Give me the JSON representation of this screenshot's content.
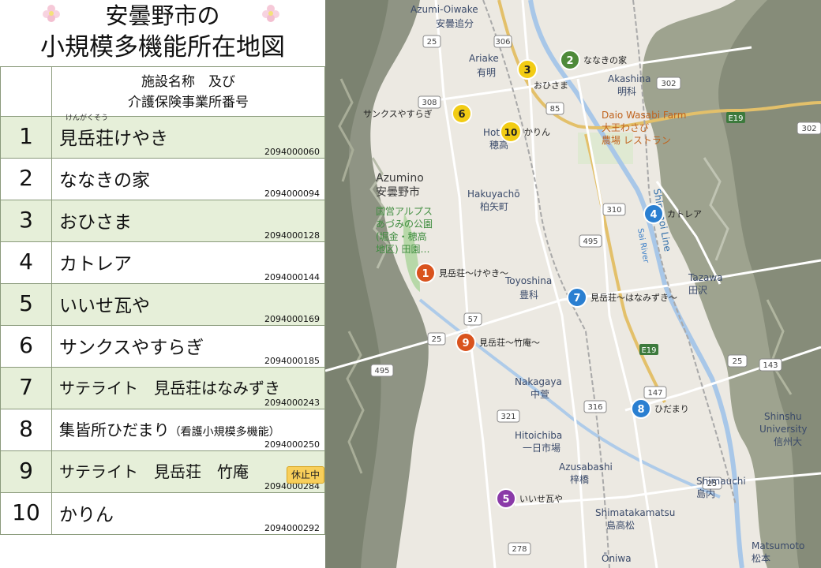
{
  "title": {
    "line1": "安曇野市の",
    "line2": "小規模多機能所在地図"
  },
  "table": {
    "header_line1": "施設名称　及び",
    "header_line2": "介護保険事業所番号",
    "rows": [
      {
        "num": "1",
        "name": "見岳荘けやき",
        "ruby": "けんがくそう",
        "code": "2094000060"
      },
      {
        "num": "2",
        "name": "ななきの家",
        "code": "2094000094"
      },
      {
        "num": "3",
        "name": "おひさま",
        "code": "2094000128"
      },
      {
        "num": "4",
        "name": "カトレア",
        "code": "2094000144"
      },
      {
        "num": "5",
        "name": "いいせ瓦や",
        "code": "2094000169"
      },
      {
        "num": "6",
        "name": "サンクスやすらぎ",
        "code": "2094000185"
      },
      {
        "num": "7",
        "name": "サテライト　見岳荘はなみずき",
        "code": "2094000243"
      },
      {
        "num": "8",
        "name": "集皆所ひだまり",
        "note": "（看護小規模多機能）",
        "code": "2094000250"
      },
      {
        "num": "9",
        "name": "サテライト　見岳荘　竹庵",
        "code": "2094000284",
        "badge": "休止中"
      },
      {
        "num": "10",
        "name": "かりん",
        "code": "2094000292"
      }
    ]
  },
  "map": {
    "markers": [
      {
        "num": "1",
        "label": "見岳荘～けやき～",
        "color": "#d9531e"
      },
      {
        "num": "2",
        "label": "ななきの家",
        "color": "#4e8a3a"
      },
      {
        "num": "3",
        "label": "おひさま",
        "color": "#f2cc14"
      },
      {
        "num": "4",
        "label": "カトレア",
        "color": "#2a7fd1"
      },
      {
        "num": "5",
        "label": "いいせ瓦や",
        "color": "#8a3aa8"
      },
      {
        "num": "6",
        "label": "サンクスやすらぎ",
        "color": "#f2cc14"
      },
      {
        "num": "7",
        "label": "見岳荘～はなみずき～",
        "color": "#2a7fd1"
      },
      {
        "num": "8",
        "label": "ひだまり",
        "color": "#2a7fd1"
      },
      {
        "num": "9",
        "label": "見岳荘～竹庵～",
        "color": "#d9531e"
      },
      {
        "num": "10",
        "label": "かりん",
        "color": "#f2cc14"
      }
    ],
    "places": {
      "azumi_oiwake": "Azumi-Oiwake",
      "azumi_oiwake_jp": "安曇追分",
      "ariake": "Ariake",
      "ariake_jp": "有明",
      "akashina": "Akashina",
      "akashina_jp": "明科",
      "daio_wasabi": "Daio Wasabi Farm",
      "daio_wasabi_jp1": "大王わさび",
      "daio_wasabi_jp2": "農場 レストラン",
      "hotaka": "Hota",
      "hotaka_jp": "穂高",
      "azumino": "Azumino",
      "azumino_jp": "安曇野市",
      "park1": "国営アルプス",
      "park2": "あづみの公園",
      "park3": "(堀金・穂高",
      "park4": "地区) 田園…",
      "hakuyacho": "Hakuyachō",
      "hakuyacho_jp": "柏矢町",
      "toyoshina": "Toyoshina",
      "toyoshina_jp": "豊科",
      "tazawa": "Tazawa",
      "tazawa_jp": "田沢",
      "shinonoi1": "Shinonoi Line",
      "sai_river": "Sai River",
      "nakagaya": "Nakagaya",
      "nakagaya_jp": "中萱",
      "hitoichiba": "Hitoichiba",
      "hitoichiba_jp": "一日市場",
      "azusabashi": "Azusabashi",
      "azusabashi_jp": "梓橋",
      "shimauchi": "Shimauchi",
      "shimauchi_jp": "島内",
      "shimatakamatsu": "Shimatakamatsu",
      "shimatakamatsu_jp": "島高松",
      "shinshu1": "Shinshu",
      "shinshu2": "University",
      "shinshu_jp": "信州大",
      "matsumoto": "Matsumoto",
      "matsumoto_jp": "松本",
      "oniwa": "Ōniwa"
    },
    "routes": {
      "r25a": "25",
      "r25b": "25",
      "r25c": "25",
      "r25d": "25",
      "r85": "85",
      "r302a": "302",
      "r302b": "302",
      "r306": "306",
      "r308": "308",
      "r310": "310",
      "r495a": "495",
      "r495b": "495",
      "r57": "57",
      "r316": "316",
      "r321": "321",
      "r147": "147",
      "r143": "143",
      "r278": "278",
      "re19a": "E19",
      "re19b": "E19"
    }
  }
}
